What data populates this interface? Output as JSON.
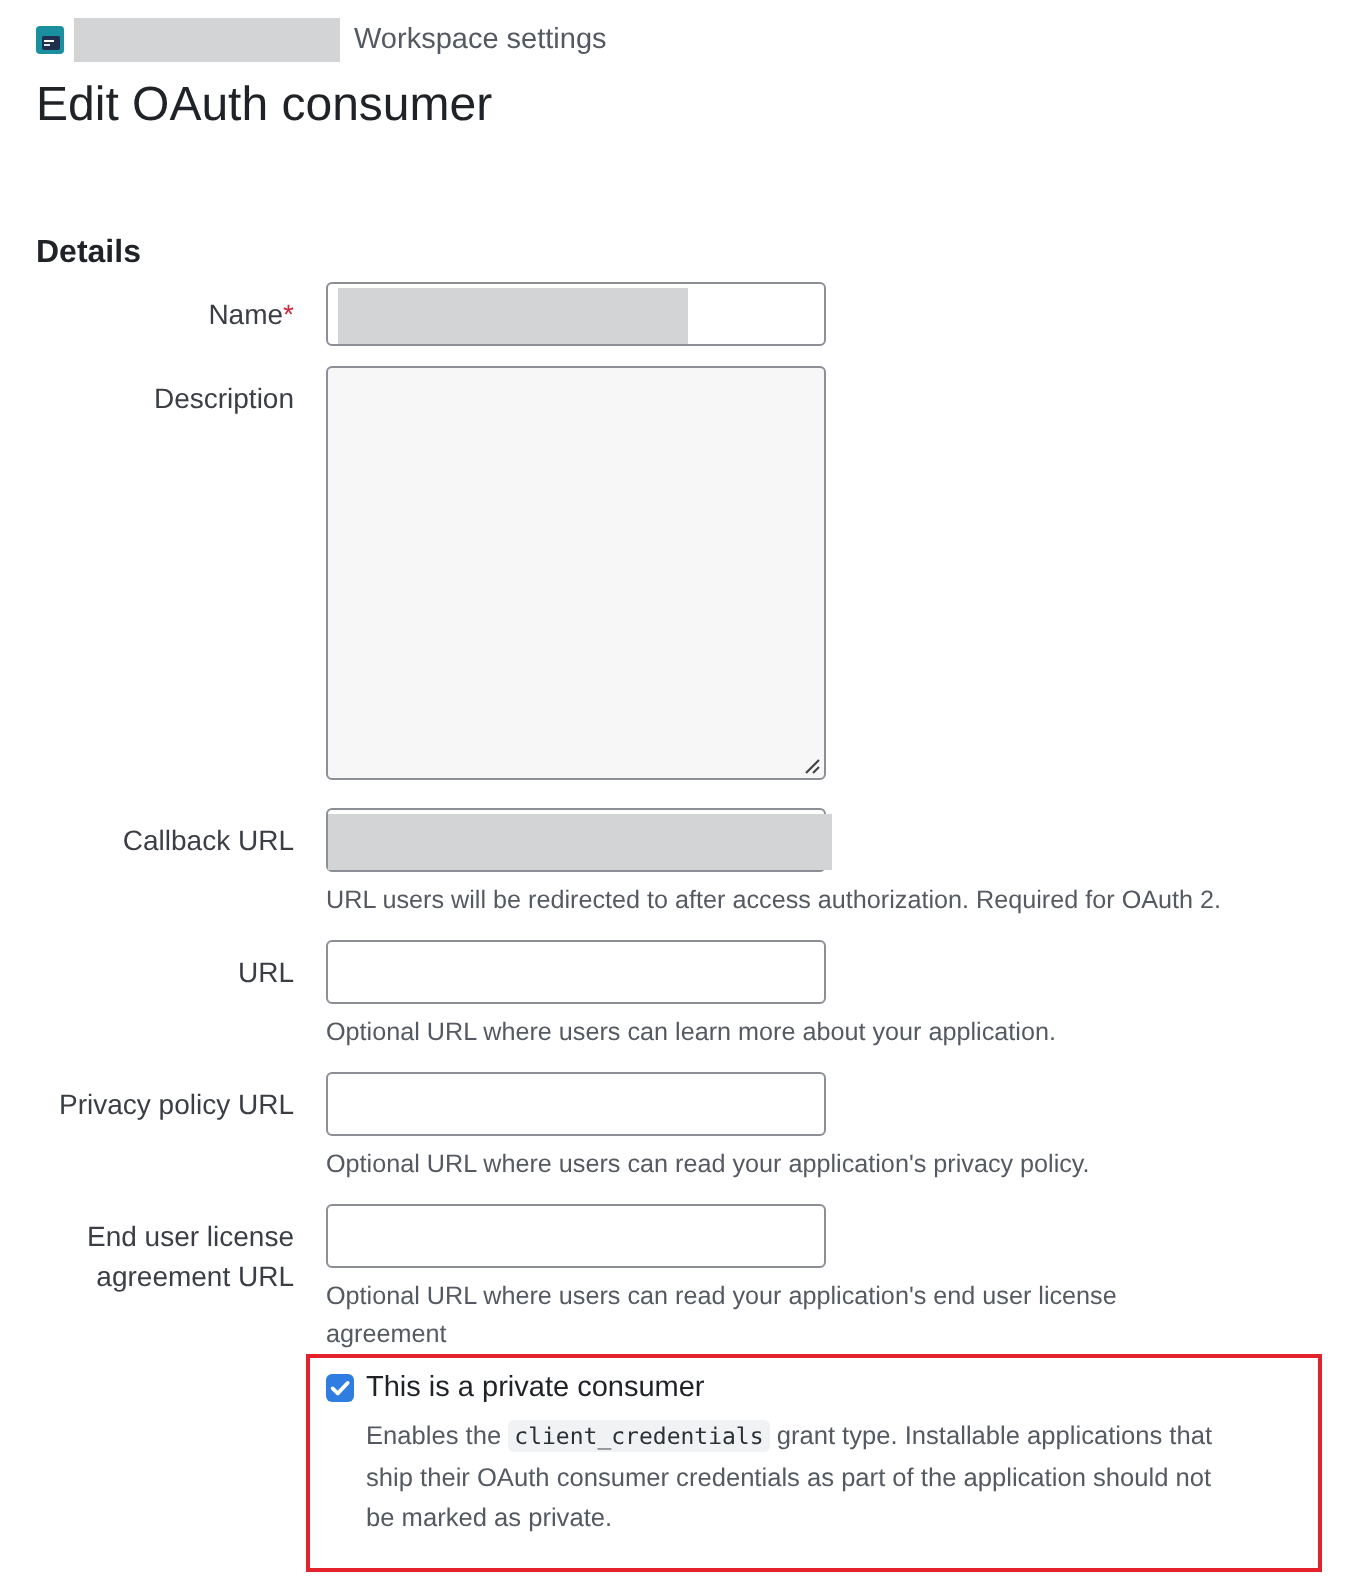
{
  "breadcrumb": {
    "workspace_redacted": true,
    "label": "Workspace settings"
  },
  "title": "Edit OAuth consumer",
  "section": "Details",
  "fields": [
    {
      "kind": "input",
      "label": "Name",
      "required_mark": "*",
      "redacted": true,
      "redaction_covers_field": false
    },
    {
      "kind": "textarea",
      "label": "Description"
    },
    {
      "kind": "input",
      "label": "Callback URL",
      "redacted": true,
      "redaction_covers_field": true,
      "help": "URL users will be redirected to after access authorization. Required for OAuth 2."
    },
    {
      "kind": "input",
      "label": "URL",
      "help": "Optional URL where users can learn more about your application."
    },
    {
      "kind": "input",
      "label": "Privacy policy URL",
      "help": "Optional URL where users can read your application's privacy policy."
    },
    {
      "kind": "input",
      "label": "End user license agreement URL",
      "help": "Optional URL where users can read your application's end user license agreement"
    }
  ],
  "private_consumer": {
    "checked": true,
    "highlighted": true,
    "label": "This is a private consumer",
    "description": [
      {
        "kind": "text",
        "text": "Enables the "
      },
      {
        "kind": "code",
        "text": "client_credentials"
      },
      {
        "kind": "text",
        "text": " grant type. Installable applications that ship their OAuth consumer credentials as part of the application should not be marked as private."
      }
    ]
  }
}
